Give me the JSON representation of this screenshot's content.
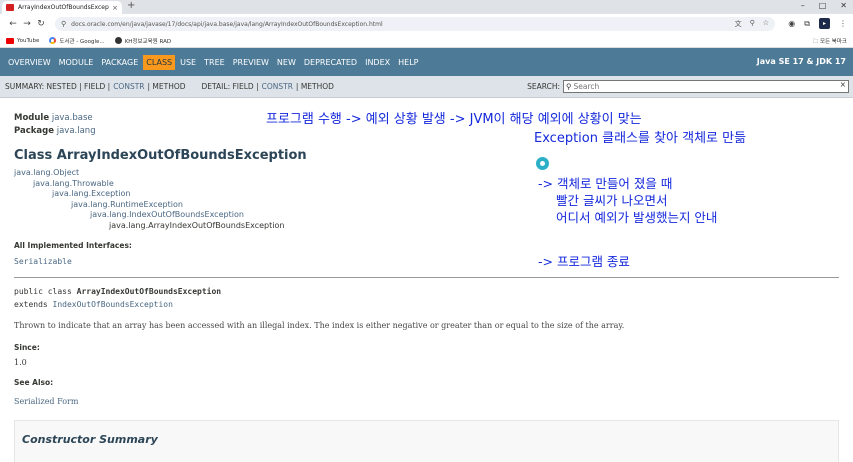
{
  "browser": {
    "tab_title": "ArrayIndexOutOfBoundsExcep",
    "tab_close": "×",
    "new_tab": "+",
    "url": "docs.oracle.com/en/java/javase/17/docs/api/java.base/java/lang/ArrayIndexOutOfBoundsException.html",
    "bookmarks": [
      {
        "label": "YouTube"
      },
      {
        "label": "도서관 - Google..."
      },
      {
        "label": "KH정보교육원 RAD"
      }
    ],
    "all_bookmarks": "모든 북마크"
  },
  "javadoc_nav": {
    "items": [
      "OVERVIEW",
      "MODULE",
      "PACKAGE",
      "CLASS",
      "USE",
      "TREE",
      "PREVIEW",
      "NEW",
      "DEPRECATED",
      "INDEX",
      "HELP"
    ],
    "active": "CLASS",
    "about": "Java SE 17 & JDK 17"
  },
  "subnav": {
    "summary_label": "SUMMARY: NESTED | FIELD |",
    "constr": "CONSTR",
    "method_pipe": "| METHOD",
    "detail_label": "DETAIL: FIELD |",
    "detail_constr": "CONSTR",
    "detail_method": "| METHOD",
    "search_label": "SEARCH:",
    "search_placeholder": "Search"
  },
  "page": {
    "module_label": "Module",
    "module": "java.base",
    "package_label": "Package",
    "package": "java.lang",
    "class_title": "Class ArrayIndexOutOfBoundsException",
    "inheritance": [
      "java.lang.Object",
      "java.lang.Throwable",
      "java.lang.Exception",
      "java.lang.RuntimeException",
      "java.lang.IndexOutOfBoundsException",
      "java.lang.ArrayIndexOutOfBoundsException"
    ],
    "interfaces_label": "All Implemented Interfaces:",
    "interfaces": "Serializable",
    "sig_line1_prefix": "public class ",
    "sig_line1_name": "ArrayIndexOutOfBoundsException",
    "sig_line2_prefix": "extends ",
    "sig_line2_link": "IndexOutOfBoundsException",
    "description": "Thrown to indicate that an array has been accessed with an illegal index. The index is either negative or greater than or equal to the size of the array.",
    "since_label": "Since:",
    "since_value": "1.0",
    "see_also_label": "See Also:",
    "see_also_link": "Serialized Form",
    "constructor_summary": "Constructor Summary"
  },
  "annotations": {
    "line1": "프로그램 수행 -> 예외 상황 발생 -> JVM이 해당 예외에 상황이 맞는",
    "line2": "Exception 클래스를 찾아 객체로 만듦",
    "line3a": "-> 객체로 만들어 졌을 때",
    "line3b": "빨간 글씨가 나오면서",
    "line3c": "어디서 예외가 발생했는지 안내",
    "line4": "-> 프로그램 종료"
  }
}
